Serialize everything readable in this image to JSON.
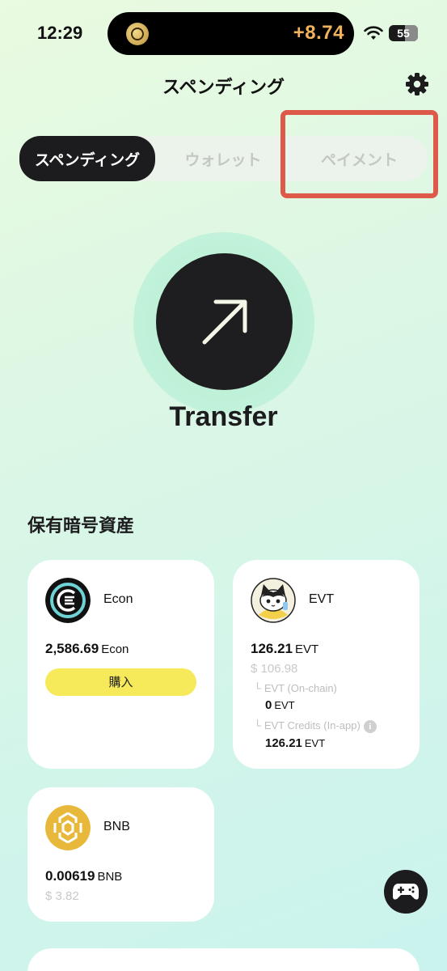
{
  "status_bar": {
    "time": "12:29",
    "live_activity_value": "+8.74",
    "battery": "55",
    "icons": [
      "coin-icon",
      "wifi-icon",
      "battery-icon"
    ]
  },
  "header": {
    "title": "スペンディング",
    "settings_icon": "gear-icon"
  },
  "tabs": [
    {
      "label": "スペンディング",
      "active": true
    },
    {
      "label": "ウォレット",
      "active": false
    },
    {
      "label": "ペイメント",
      "active": false
    }
  ],
  "transfer": {
    "label": "Transfer",
    "icon": "arrow-up-right-icon"
  },
  "assets": {
    "section_title": "保有暗号資産",
    "econ": {
      "name": "Econ",
      "amount": "2,586.69",
      "unit": "Econ",
      "buy_label": "購入"
    },
    "evt": {
      "name": "EVT",
      "amount": "126.21",
      "unit": "EVT",
      "usd": "$ 106.98",
      "onchain_label": "└ EVT (On-chain)",
      "onchain_amount": "0",
      "onchain_unit": "EVT",
      "credits_label": "└ EVT Credits (In-app)",
      "credits_amount": "126.21",
      "credits_unit": "EVT"
    },
    "bnb": {
      "name": "BNB",
      "amount": "0.00619",
      "unit": "BNB",
      "usd": "$ 3.82"
    }
  },
  "floating": {
    "icon": "gamepad-icon"
  },
  "colors": {
    "accent_dark": "#1c1b1d",
    "buy_yellow": "#f6ea5a",
    "live_orange": "#f0b35c",
    "highlight_red": "#dd5a4a",
    "bnb_gold": "#e8b83a"
  }
}
